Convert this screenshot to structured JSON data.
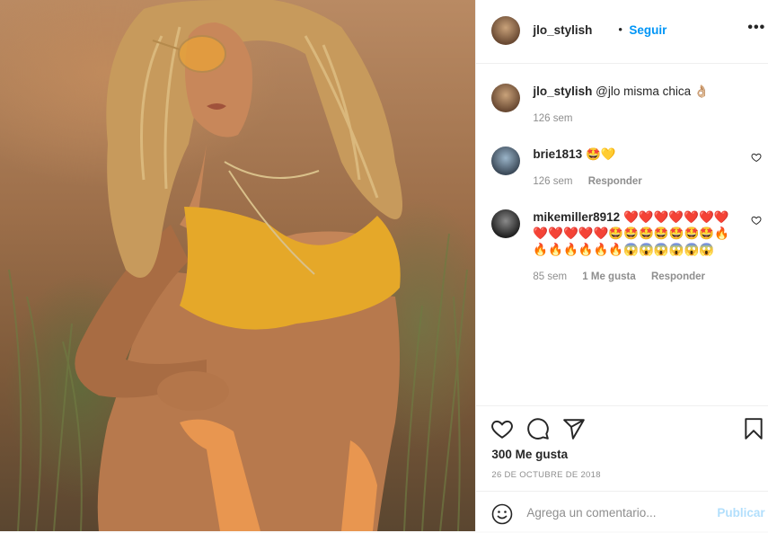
{
  "post": {
    "author": "jlo_stylish",
    "separator": "•",
    "follow_label": "Seguir",
    "more_label": "•••",
    "photo_alt": "post-photo"
  },
  "comments": [
    {
      "user": "jlo_stylish",
      "text": "@jlo misma chica 👌🏼",
      "time": "126 sem",
      "reply": "",
      "likes": "",
      "has_like_icon": false
    },
    {
      "user": "brie1813",
      "text": "🤩💛",
      "time": "126 sem",
      "reply": "Responder",
      "likes": "",
      "has_like_icon": true
    },
    {
      "user": "mikemiller8912",
      "text": "❤️❤️❤️❤️❤️❤️❤️❤️❤️❤️❤️❤️🤩🤩🤩🤩🤩🤩🤩🔥🔥🔥🔥🔥🔥🔥😱😱😱😱😱😱",
      "time": "85 sem",
      "likes": "1 Me gusta",
      "reply": "Responder",
      "has_like_icon": true
    }
  ],
  "actions": {
    "like_icon": "heart-outline-icon",
    "comment_icon": "speech-bubble-icon",
    "share_icon": "paper-plane-icon",
    "save_icon": "bookmark-icon"
  },
  "likes_text": "300 Me gusta",
  "date_text": "26 DE OCTUBRE DE 2018",
  "add_comment": {
    "placeholder": "Agrega un comentario...",
    "publish_label": "Publicar",
    "emoji_icon": "smiley-icon"
  },
  "colors": {
    "link_blue": "#0095f6",
    "publish_disabled": "#b2dffc",
    "muted": "#8e8e8e",
    "text": "#262626",
    "divider": "#efefef"
  }
}
